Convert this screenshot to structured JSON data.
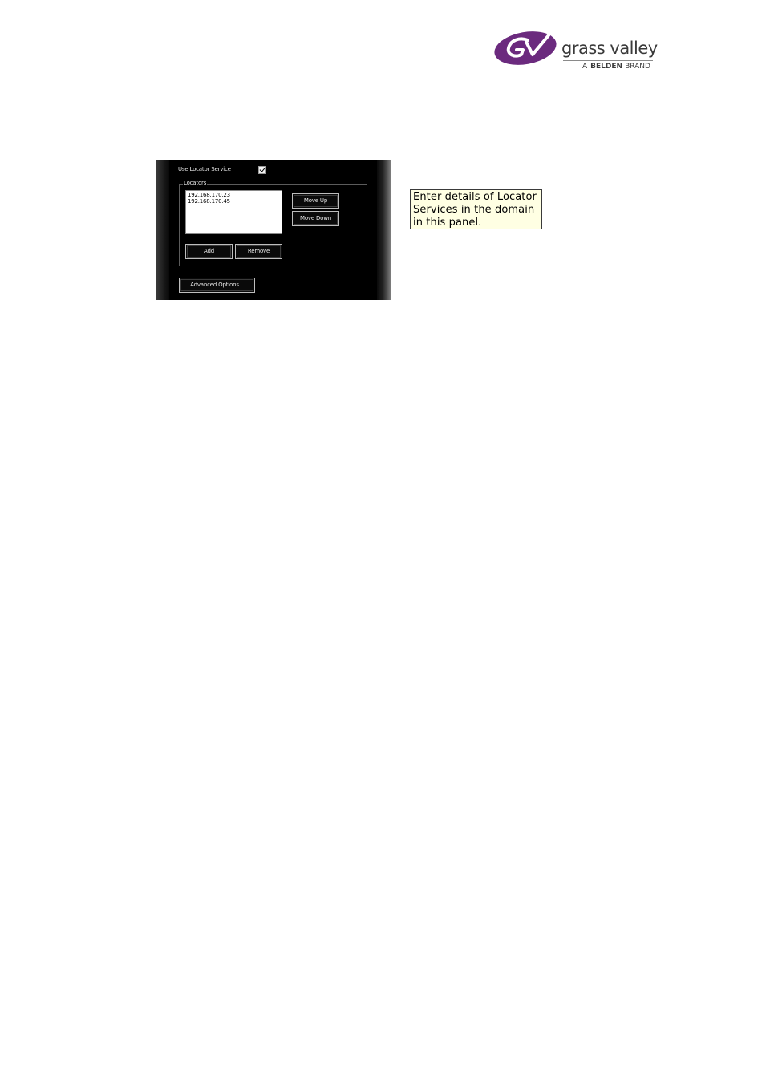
{
  "logo": {
    "wordmark": "grass valley",
    "brand_prefix": "A",
    "brand_name": "BELDEN",
    "brand_suffix": "BRAND",
    "color": "#6b2a7e"
  },
  "dialog": {
    "use_locator_label": "Use Locator Service",
    "use_locator_checked": true,
    "locators_group_label": "Locators",
    "locators": [
      "192.168.170.23",
      "192.168.170.45"
    ],
    "move_up_label": "Move Up",
    "move_down_label": "Move Down",
    "add_label": "Add",
    "remove_label": "Remove",
    "advanced_label": "Advanced Options..."
  },
  "callout": {
    "lines": [
      "Enter details of Locator",
      "Services in the domain",
      "in this panel."
    ]
  }
}
